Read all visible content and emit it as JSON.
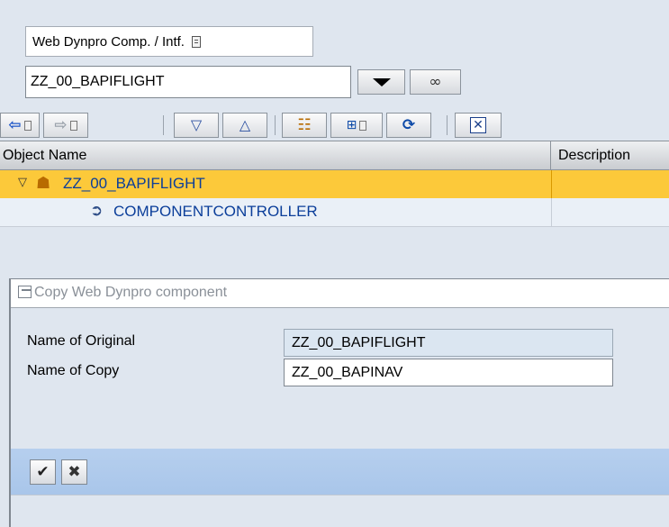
{
  "object_selector": {
    "type_value": "Web Dynpro Comp. / Intf.",
    "name_value": "ZZ_00_BAPIFLIGHT"
  },
  "toolbar": {
    "icons": [
      "back-icon",
      "forward-icon",
      "expand-icon",
      "collapse-icon",
      "hierarchy-icon",
      "select-icon",
      "refresh-icon",
      "close-icon"
    ]
  },
  "tree": {
    "columns": [
      "Object Name",
      "Description"
    ],
    "rows": [
      {
        "label": "ZZ_00_BAPIFLIGHT",
        "icon": "component-icon",
        "expanded": true,
        "selected": true
      },
      {
        "label": "COMPONENTCONTROLLER",
        "icon": "controller-icon"
      }
    ]
  },
  "dialog": {
    "title": "Copy Web Dynpro component",
    "fields": [
      {
        "label": "Name of Original",
        "value": "ZZ_00_BAPIFLIGHT",
        "readonly": true
      },
      {
        "label": "Name of Copy",
        "value": "ZZ_00_BAPINAV",
        "readonly": false
      }
    ],
    "buttons": [
      "confirm-icon",
      "cancel-icon"
    ]
  },
  "colors": {
    "selected_row": "#fcc93a",
    "link_text": "#0b3e9a",
    "dialog_footer": "#b1cbed",
    "background": "#dfe6ef"
  }
}
